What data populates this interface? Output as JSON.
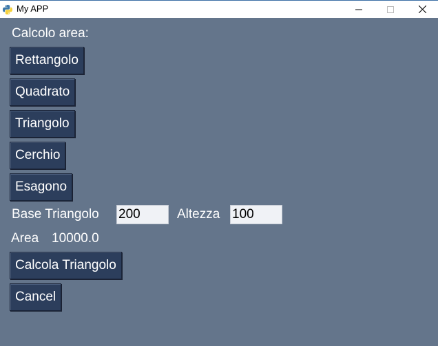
{
  "window": {
    "title": "My APP",
    "controls": {
      "minimize": "—",
      "maximize": "☐",
      "close": "✕"
    },
    "app_icon": "python-icon"
  },
  "content": {
    "heading": "Calcolo area:",
    "shape_buttons": {
      "rettangolo": "Rettangolo",
      "quadrato": "Quadrato",
      "triangolo": "Triangolo",
      "cerchio": "Cerchio",
      "esagono": "Esagono"
    },
    "base_label": "Base Triangolo",
    "base_value": "200",
    "altezza_label": "Altezza",
    "altezza_value": "100",
    "area_label": "Area",
    "area_value": "10000.0",
    "calcola_button": "Calcola Triangolo",
    "cancel_button": "Cancel"
  },
  "colors": {
    "background": "#64758b",
    "button": "#2c3e5c",
    "entry": "#f0f2f6",
    "text": "#ffffff"
  }
}
